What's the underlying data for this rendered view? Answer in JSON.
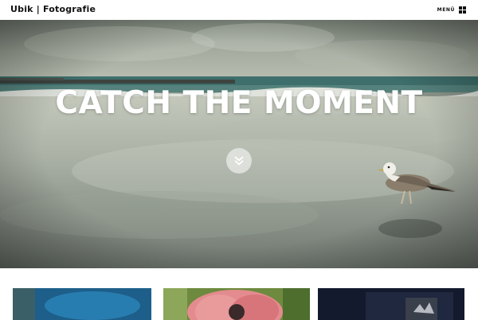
{
  "header": {
    "site_title": "Ubik | Fotografie",
    "menu_label": "MENÜ",
    "menu_icon": "grid-icon"
  },
  "hero": {
    "title": "CATCH THE MOMENT",
    "scroll_icon": "double-chevron-down-icon",
    "image_subject": "seagull on beach"
  },
  "gallery": {
    "items": [
      {
        "name": "gallery-photo-blue"
      },
      {
        "name": "gallery-photo-poppy"
      },
      {
        "name": "gallery-photo-dark"
      }
    ]
  },
  "colors": {
    "text": "#111111",
    "hero_title": "#ffffff",
    "background": "#ffffff"
  }
}
